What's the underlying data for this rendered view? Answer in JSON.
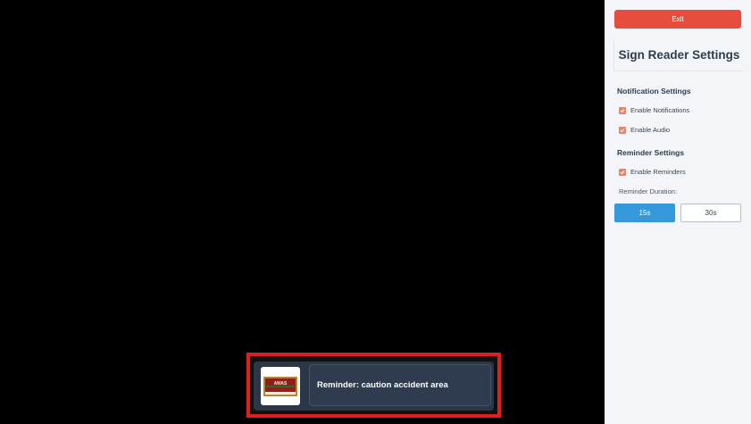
{
  "settings": {
    "exit_label": "Exit",
    "title": "Sign Reader Settings",
    "notification_section": "Notification Settings",
    "enable_notifications": {
      "label": "Enable Notifications",
      "checked": true
    },
    "enable_audio": {
      "label": "Enable Audio",
      "checked": true
    },
    "reminder_section": "Reminder Settings",
    "enable_reminders": {
      "label": "Enable Reminders",
      "checked": true
    },
    "duration_label": "Reminder Duration:",
    "duration_options": [
      {
        "label": "15s",
        "selected": true
      },
      {
        "label": "30s",
        "selected": false
      }
    ]
  },
  "notification": {
    "message": "Reminder: caution accident area",
    "sign_icon": "road-sign-thumbnail"
  },
  "colors": {
    "exit": "#e74c3c",
    "checkbox": "#e8846a",
    "selected_duration": "#3498db",
    "highlight": "#e11d1d",
    "toast_bg": "#2b3647"
  }
}
